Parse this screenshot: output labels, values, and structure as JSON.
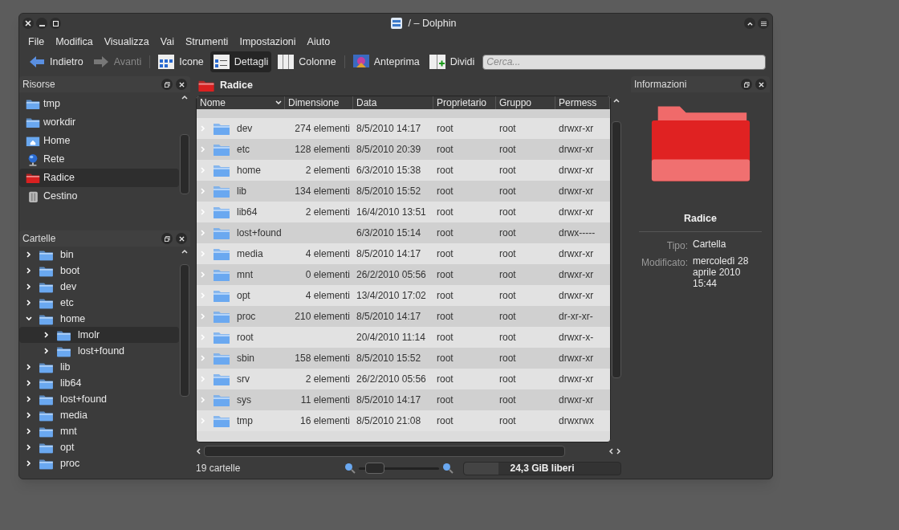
{
  "window": {
    "title": "/ – Dolphin"
  },
  "menu": [
    "File",
    "Modifica",
    "Visualizza",
    "Vai",
    "Strumenti",
    "Impostazioni",
    "Aiuto"
  ],
  "toolbar": [
    {
      "kind": "back",
      "label": "Indietro",
      "disabled": false,
      "selected": false
    },
    {
      "kind": "forward",
      "label": "Avanti",
      "disabled": true,
      "selected": false
    },
    {
      "kind": "separator"
    },
    {
      "kind": "icons",
      "label": "Icone",
      "disabled": false,
      "selected": false
    },
    {
      "kind": "details",
      "label": "Dettagli",
      "disabled": false,
      "selected": true
    },
    {
      "kind": "columns",
      "label": "Colonne",
      "disabled": false,
      "selected": false
    },
    {
      "kind": "separator"
    },
    {
      "kind": "preview",
      "label": "Anteprima",
      "disabled": false,
      "selected": false
    },
    {
      "kind": "split",
      "label": "Dividi",
      "disabled": false,
      "selected": false
    }
  ],
  "search": {
    "placeholder": "Cerca..."
  },
  "places": {
    "title": "Risorse",
    "items": [
      {
        "kind": "folder",
        "label": "tmp",
        "selected": false
      },
      {
        "kind": "folder",
        "label": "workdir",
        "selected": false
      },
      {
        "kind": "home",
        "label": "Home",
        "selected": false
      },
      {
        "kind": "network",
        "label": "Rete",
        "selected": false
      },
      {
        "kind": "root",
        "label": "Radice",
        "selected": true
      },
      {
        "kind": "trash",
        "label": "Cestino",
        "selected": false
      }
    ]
  },
  "folders": {
    "title": "Cartelle",
    "items": [
      {
        "label": "bin",
        "expanded": false,
        "selected": false
      },
      {
        "label": "boot",
        "expanded": false,
        "selected": false
      },
      {
        "label": "dev",
        "expanded": false,
        "selected": false
      },
      {
        "label": "etc",
        "expanded": false,
        "selected": false
      },
      {
        "label": "home",
        "expanded": true,
        "selected": false,
        "children": [
          {
            "label": "lmolr",
            "expanded": false,
            "selected": true
          },
          {
            "label": "lost+found",
            "expanded": false,
            "selected": false
          }
        ]
      },
      {
        "label": "lib",
        "expanded": false,
        "selected": false
      },
      {
        "label": "lib64",
        "expanded": false,
        "selected": false
      },
      {
        "label": "lost+found",
        "expanded": false,
        "selected": false
      },
      {
        "label": "media",
        "expanded": false,
        "selected": false
      },
      {
        "label": "mnt",
        "expanded": false,
        "selected": false
      },
      {
        "label": "opt",
        "expanded": false,
        "selected": false
      },
      {
        "label": "proc",
        "expanded": false,
        "selected": false
      }
    ]
  },
  "location": "Radice",
  "table": {
    "columns": [
      "Nome",
      "Dimensione",
      "Data",
      "Proprietario",
      "Gruppo",
      "Permess"
    ],
    "rows": [
      [
        "dev",
        "274 elementi",
        "8/5/2010 14:17",
        "root",
        "root",
        "drwxr-xr"
      ],
      [
        "etc",
        "128 elementi",
        "8/5/2010 20:39",
        "root",
        "root",
        "drwxr-xr"
      ],
      [
        "home",
        "2 elementi",
        "6/3/2010 15:38",
        "root",
        "root",
        "drwxr-xr"
      ],
      [
        "lib",
        "134 elementi",
        "8/5/2010 15:52",
        "root",
        "root",
        "drwxr-xr"
      ],
      [
        "lib64",
        "2 elementi",
        "16/4/2010 13:51",
        "root",
        "root",
        "drwxr-xr"
      ],
      [
        "lost+found",
        "",
        "6/3/2010 15:14",
        "root",
        "root",
        "drwx-----"
      ],
      [
        "media",
        "4 elementi",
        "8/5/2010 14:17",
        "root",
        "root",
        "drwxr-xr"
      ],
      [
        "mnt",
        "0 elementi",
        "26/2/2010 05:56",
        "root",
        "root",
        "drwxr-xr"
      ],
      [
        "opt",
        "4 elementi",
        "13/4/2010 17:02",
        "root",
        "root",
        "drwxr-xr"
      ],
      [
        "proc",
        "210 elementi",
        "8/5/2010 14:17",
        "root",
        "root",
        "dr-xr-xr-"
      ],
      [
        "root",
        "",
        "20/4/2010 11:14",
        "root",
        "root",
        "drwxr-x-"
      ],
      [
        "sbin",
        "158 elementi",
        "8/5/2010 15:52",
        "root",
        "root",
        "drwxr-xr"
      ],
      [
        "srv",
        "2 elementi",
        "26/2/2010 05:56",
        "root",
        "root",
        "drwxr-xr"
      ],
      [
        "sys",
        "11 elementi",
        "8/5/2010 14:17",
        "root",
        "root",
        "drwxr-xr"
      ],
      [
        "tmp",
        "16 elementi",
        "8/5/2010 21:08",
        "root",
        "root",
        "drwxrwx"
      ]
    ]
  },
  "status": {
    "count": "19 cartelle",
    "zoom": {
      "level": 0.1
    },
    "space": {
      "label": "24,3 GiB liberi",
      "level": 0.22
    }
  },
  "info": {
    "title": "Informazioni",
    "name": "Radice",
    "fields": [
      {
        "label": "Tipo:",
        "value": "Cartella"
      },
      {
        "label": "Modificato:",
        "value": "mercoledì 28 aprile 2010 15:44"
      }
    ]
  }
}
